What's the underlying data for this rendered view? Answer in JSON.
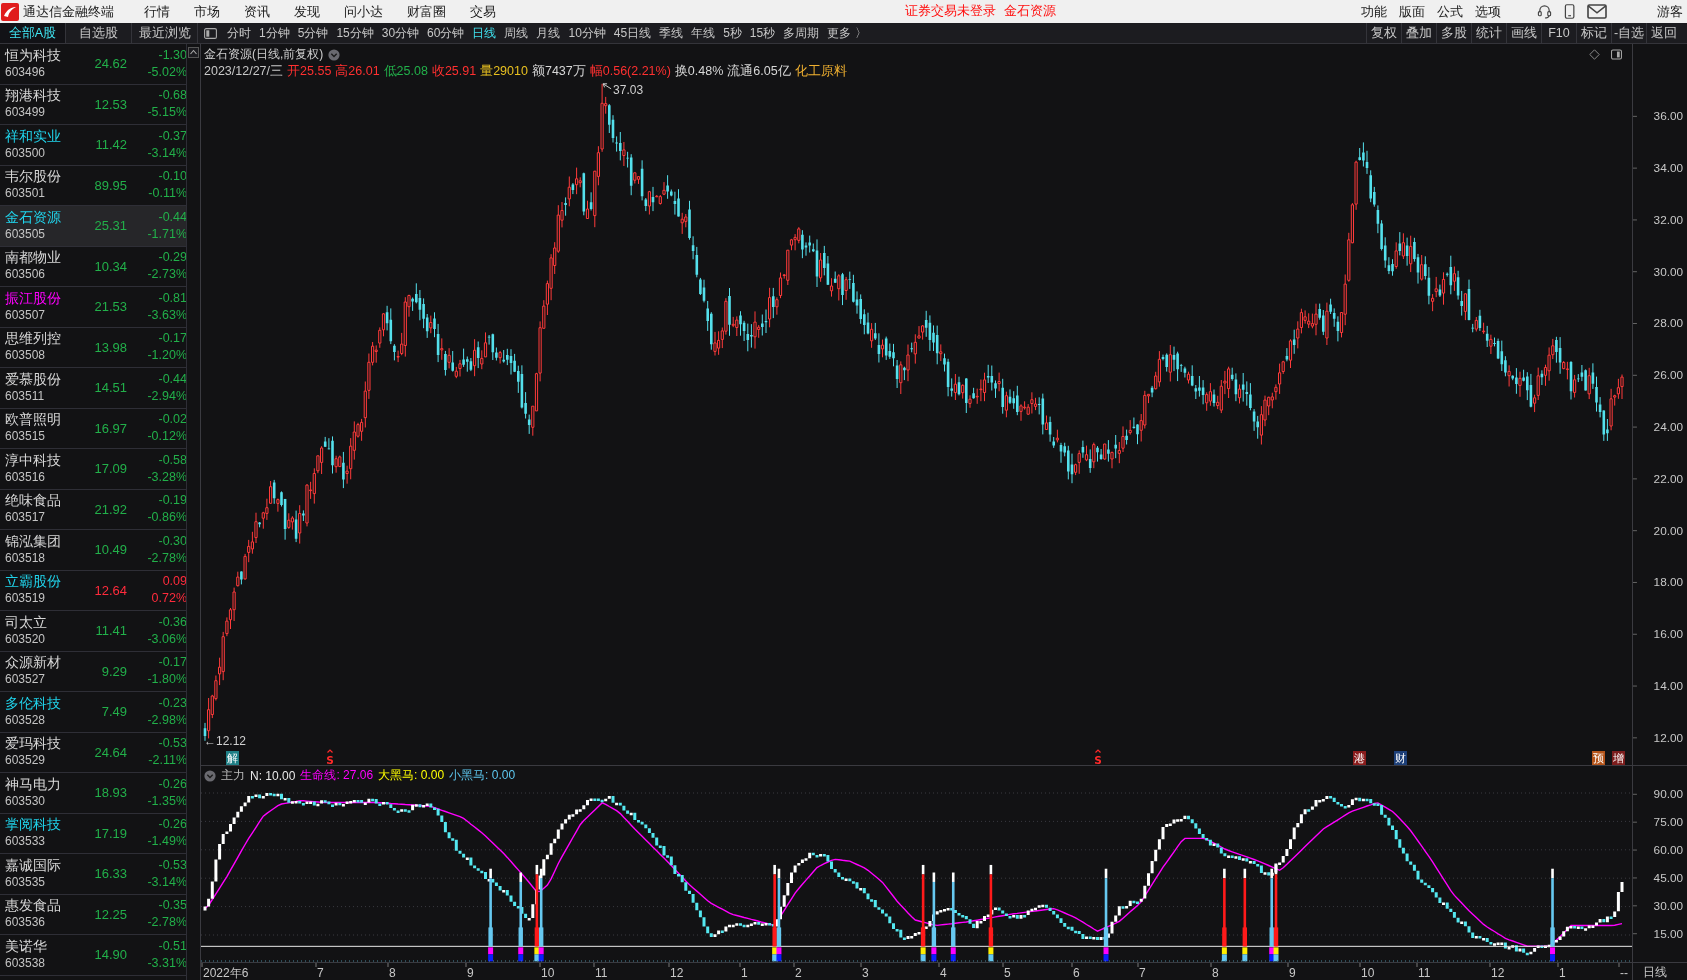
{
  "app": {
    "title": "通达信金融终端"
  },
  "menu": [
    "行情",
    "市场",
    "资讯",
    "发现",
    "问小达",
    "财富圈",
    "交易"
  ],
  "notice": [
    "证券交易未登录",
    "金石资源"
  ],
  "system_menu": [
    "功能",
    "版面",
    "公式",
    "选项"
  ],
  "user": "游客",
  "list_tabs": [
    {
      "label": "全部A股",
      "selected": true
    },
    {
      "label": "自选股",
      "selected": false
    },
    {
      "label": "最近浏览",
      "selected": false
    }
  ],
  "period_tabs": [
    {
      "label": "分时",
      "selected": false
    },
    {
      "label": "1分钟",
      "selected": false
    },
    {
      "label": "5分钟",
      "selected": false
    },
    {
      "label": "15分钟",
      "selected": false
    },
    {
      "label": "30分钟",
      "selected": false
    },
    {
      "label": "60分钟",
      "selected": false
    },
    {
      "label": "日线",
      "selected": true
    },
    {
      "label": "周线",
      "selected": false
    },
    {
      "label": "月线",
      "selected": false
    },
    {
      "label": "10分钟",
      "selected": false
    },
    {
      "label": "45日线",
      "selected": false
    },
    {
      "label": "季线",
      "selected": false
    },
    {
      "label": "年线",
      "selected": false
    },
    {
      "label": "5秒",
      "selected": false
    },
    {
      "label": "15秒",
      "selected": false
    },
    {
      "label": "多周期",
      "selected": false
    },
    {
      "label": "更多 〉",
      "selected": false
    }
  ],
  "tools": [
    "复权",
    "叠加",
    "多股",
    "统计",
    "画线",
    "F10",
    "标记",
    "-自选",
    "返回"
  ],
  "stocks": [
    {
      "name": "恒为科技",
      "code": "603496",
      "price": "24.62",
      "change": "-1.30",
      "percent": "-5.02%",
      "rising": false,
      "color": "#d8d8d8",
      "selected": false
    },
    {
      "name": "翔港科技",
      "code": "603499",
      "price": "12.53",
      "change": "-0.68",
      "percent": "-5.15%",
      "rising": false,
      "color": "#d8d8d8",
      "selected": false
    },
    {
      "name": "祥和实业",
      "code": "603500",
      "price": "11.42",
      "change": "-0.37",
      "percent": "-3.14%",
      "rising": false,
      "color": "#20d4ec",
      "selected": false
    },
    {
      "name": "韦尔股份",
      "code": "603501",
      "price": "89.95",
      "change": "-0.10",
      "percent": "-0.11%",
      "rising": false,
      "color": "#d8d8d8",
      "selected": false
    },
    {
      "name": "金石资源",
      "code": "603505",
      "price": "25.31",
      "change": "-0.44",
      "percent": "-1.71%",
      "rising": false,
      "color": "#20d4ec",
      "selected": true
    },
    {
      "name": "南都物业",
      "code": "603506",
      "price": "10.34",
      "change": "-0.29",
      "percent": "-2.73%",
      "rising": false,
      "color": "#d8d8d8",
      "selected": false
    },
    {
      "name": "振江股份",
      "code": "603507",
      "price": "21.53",
      "change": "-0.81",
      "percent": "-3.63%",
      "rising": false,
      "color": "#ff00ff",
      "selected": false
    },
    {
      "name": "思维列控",
      "code": "603508",
      "price": "13.98",
      "change": "-0.17",
      "percent": "-1.20%",
      "rising": false,
      "color": "#d8d8d8",
      "selected": false
    },
    {
      "name": "爱慕股份",
      "code": "603511",
      "price": "14.51",
      "change": "-0.44",
      "percent": "-2.94%",
      "rising": false,
      "color": "#d8d8d8",
      "selected": false
    },
    {
      "name": "欧普照明",
      "code": "603515",
      "price": "16.97",
      "change": "-0.02",
      "percent": "-0.12%",
      "rising": false,
      "color": "#d8d8d8",
      "selected": false
    },
    {
      "name": "淳中科技",
      "code": "603516",
      "price": "17.09",
      "change": "-0.58",
      "percent": "-3.28%",
      "rising": false,
      "color": "#d8d8d8",
      "selected": false
    },
    {
      "name": "绝味食品",
      "code": "603517",
      "price": "21.92",
      "change": "-0.19",
      "percent": "-0.86%",
      "rising": false,
      "color": "#d8d8d8",
      "selected": false
    },
    {
      "name": "锦泓集团",
      "code": "603518",
      "price": "10.49",
      "change": "-0.30",
      "percent": "-2.78%",
      "rising": false,
      "color": "#d8d8d8",
      "selected": false
    },
    {
      "name": "立霸股份",
      "code": "603519",
      "price": "12.64",
      "change": "0.09",
      "percent": "0.72%",
      "rising": true,
      "color": "#20d4ec",
      "selected": false
    },
    {
      "name": "司太立",
      "code": "603520",
      "price": "11.41",
      "change": "-0.36",
      "percent": "-3.06%",
      "rising": false,
      "color": "#d8d8d8",
      "selected": false
    },
    {
      "name": "众源新材",
      "code": "603527",
      "price": "9.29",
      "change": "-0.17",
      "percent": "-1.80%",
      "rising": false,
      "color": "#d8d8d8",
      "selected": false
    },
    {
      "name": "多伦科技",
      "code": "603528",
      "price": "7.49",
      "change": "-0.23",
      "percent": "-2.98%",
      "rising": false,
      "color": "#20d4ec",
      "selected": false
    },
    {
      "name": "爱玛科技",
      "code": "603529",
      "price": "24.64",
      "change": "-0.53",
      "percent": "-2.11%",
      "rising": false,
      "color": "#d8d8d8",
      "selected": false
    },
    {
      "name": "神马电力",
      "code": "603530",
      "price": "18.93",
      "change": "-0.26",
      "percent": "-1.35%",
      "rising": false,
      "color": "#d8d8d8",
      "selected": false
    },
    {
      "name": "掌阅科技",
      "code": "603533",
      "price": "17.19",
      "change": "-0.26",
      "percent": "-1.49%",
      "rising": false,
      "color": "#20d4ec",
      "selected": false
    },
    {
      "name": "嘉诚国际",
      "code": "603535",
      "price": "16.33",
      "change": "-0.53",
      "percent": "-3.14%",
      "rising": false,
      "color": "#d8d8d8",
      "selected": false
    },
    {
      "name": "惠发食品",
      "code": "603536",
      "price": "12.25",
      "change": "-0.35",
      "percent": "-2.78%",
      "rising": false,
      "color": "#d8d8d8",
      "selected": false
    },
    {
      "name": "美诺华",
      "code": "603538",
      "price": "14.90",
      "change": "-0.51",
      "percent": "-3.31%",
      "rising": false,
      "color": "#d8d8d8",
      "selected": false
    }
  ],
  "chart": {
    "title": "金石资源(日线,前复权)",
    "quote": [
      {
        "text": "2023/12/27/三",
        "color": "#c8c8c8"
      },
      {
        "text": "开25.55",
        "color": "#ff3030"
      },
      {
        "text": "高26.01",
        "color": "#ff3030"
      },
      {
        "text": "低25.08",
        "color": "#22b04a"
      },
      {
        "text": "收25.91",
        "color": "#ff3030"
      },
      {
        "text": "量29010",
        "color": "#e8c020"
      },
      {
        "text": "额7437万",
        "color": "#d8d8d8"
      },
      {
        "text": "幅0.56(2.21%)",
        "color": "#ff3030"
      },
      {
        "text": "换0.48%",
        "color": "#d8d8d8"
      },
      {
        "text": "流通6.05亿",
        "color": "#d8d8d8"
      },
      {
        "text": "化工原料",
        "color": "#f0b030"
      }
    ],
    "high_label": "37.03",
    "low_label": "←12.12",
    "price_ticks": [
      "36.00",
      "34.00",
      "32.00",
      "30.00",
      "28.00",
      "26.00",
      "24.00",
      "22.00",
      "20.00",
      "18.00",
      "16.00",
      "14.00",
      "12.00"
    ],
    "events": [
      {
        "text": "解",
        "kind": "tag",
        "color": "#1f7f86"
      },
      {
        "text": "S",
        "kind": "signal",
        "color": "#ff2a2a"
      },
      {
        "text": "S",
        "kind": "signal",
        "color": "#ff2a2a"
      },
      {
        "text": "港",
        "kind": "tag",
        "color": "#8a1c1c"
      },
      {
        "text": "财",
        "kind": "tag",
        "color": "#1d3f78"
      },
      {
        "text": "预",
        "kind": "tag",
        "color": "#b4541a"
      },
      {
        "text": "增",
        "kind": "tag",
        "color": "#7c1d1d"
      }
    ]
  },
  "indicator": {
    "name": "主力",
    "params": [
      {
        "text": "N: 10.00",
        "color": "#e8e8e8"
      },
      {
        "text": "生命线: 27.06",
        "color": "#ff00ff"
      },
      {
        "text": "大黑马: 0.00",
        "color": "#ffff00"
      },
      {
        "text": "小黑马: 0.00",
        "color": "#5ec8f0"
      }
    ],
    "ticks": [
      "90.00",
      "75.00",
      "60.00",
      "45.00",
      "30.00",
      "15.00"
    ]
  },
  "time_axis": {
    "ticks": [
      "2022年6",
      "7",
      "8",
      "9",
      "10",
      "11",
      "12",
      "1",
      "2",
      "3",
      "4",
      "5",
      "6",
      "7",
      "8",
      "9",
      "10",
      "11",
      "12",
      "1",
      "--"
    ],
    "period": "日线"
  }
}
